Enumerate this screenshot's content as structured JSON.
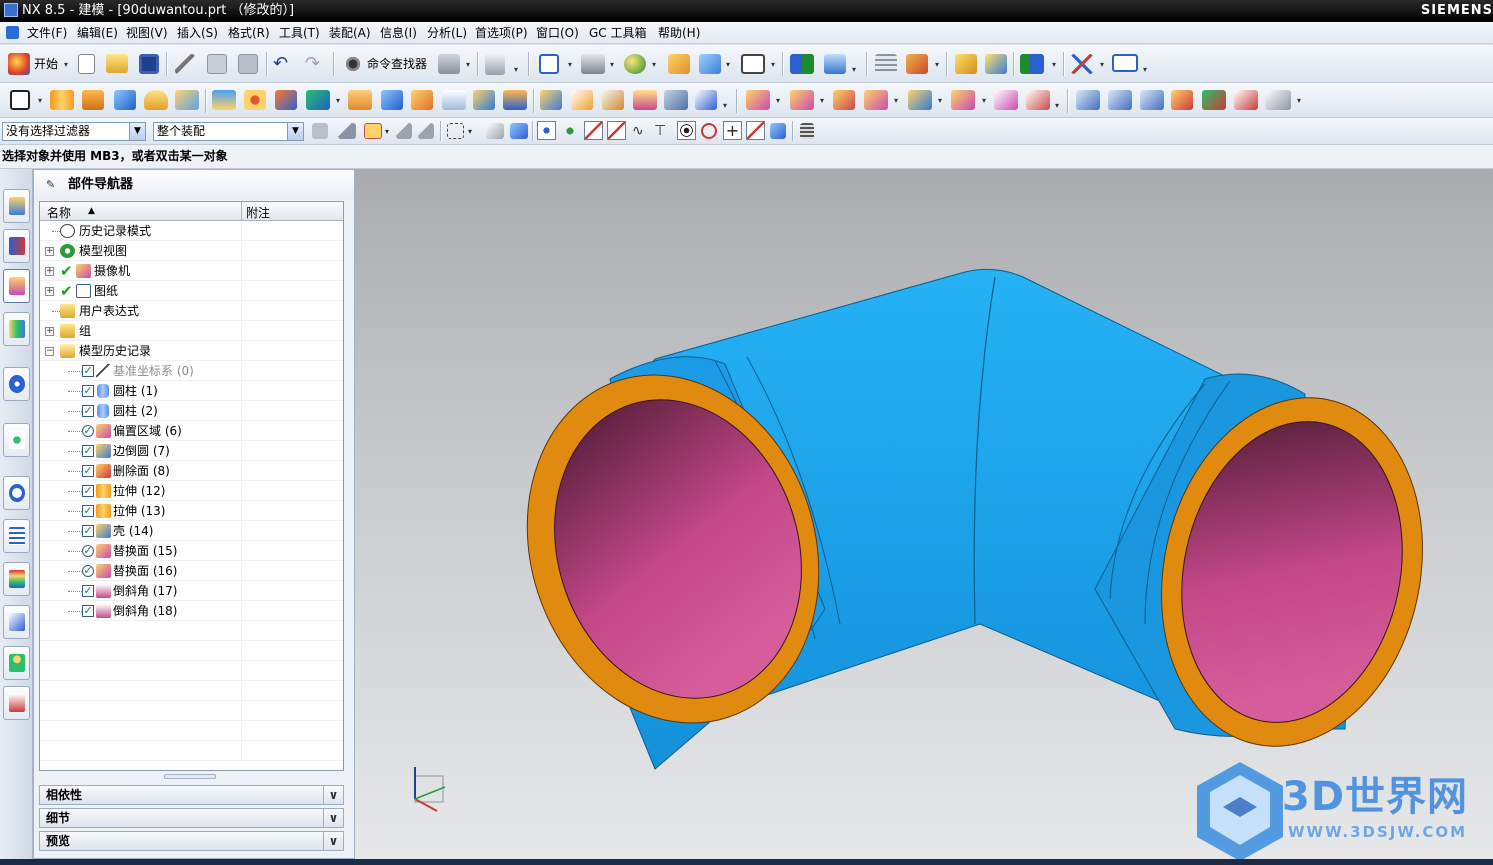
{
  "window": {
    "title": "NX 8.5 - 建模 - [90duwantou.prt （修改的）]",
    "brand": "SIEMENS"
  },
  "menu": [
    "文件(F)",
    "编辑(E)",
    "视图(V)",
    "插入(S)",
    "格式(R)",
    "工具(T)",
    "装配(A)",
    "信息(I)",
    "分析(L)",
    "首选项(P)",
    "窗口(O)",
    "GC 工具箱",
    "帮助(H)"
  ],
  "toolbar": {
    "start_label": "开始",
    "command_finder_label": "命令查找器",
    "selection_filter": "没有选择过滤器",
    "assembly_scope": "整个装配"
  },
  "cue_line": "选择对象并使用 MB3，或者双击某一对象",
  "navigator": {
    "title": "部件导航器",
    "col_name": "名称",
    "col_note": "附注",
    "items": [
      {
        "label": "历史记录模式",
        "icon": "clock-icon"
      },
      {
        "label": "模型视图",
        "icon": "model-views-icon"
      },
      {
        "label": "摄像机",
        "icon": "camera-icon"
      },
      {
        "label": "图纸",
        "icon": "drawing-icon"
      },
      {
        "label": "用户表达式",
        "icon": "folder-icon"
      },
      {
        "label": "组",
        "icon": "folder-icon"
      },
      {
        "label": "模型历史记录",
        "icon": "folder-open-icon"
      },
      {
        "label": "基准坐标系 (0)",
        "icon": "datum-csys-icon"
      },
      {
        "label": "圆柱 (1)",
        "icon": "cylinder-icon"
      },
      {
        "label": "圆柱 (2)",
        "icon": "cylinder-icon"
      },
      {
        "label": "偏置区域 (6)",
        "icon": "offset-region-icon"
      },
      {
        "label": "边倒圆 (7)",
        "icon": "edge-blend-icon"
      },
      {
        "label": "删除面 (8)",
        "icon": "delete-face-icon"
      },
      {
        "label": "拉伸 (12)",
        "icon": "extrude-icon"
      },
      {
        "label": "拉伸 (13)",
        "icon": "extrude-icon"
      },
      {
        "label": "壳 (14)",
        "icon": "shell-icon"
      },
      {
        "label": "替换面 (15)",
        "icon": "replace-face-icon"
      },
      {
        "label": "替换面 (16)",
        "icon": "replace-face-icon"
      },
      {
        "label": "倒斜角 (17)",
        "icon": "chamfer-icon"
      },
      {
        "label": "倒斜角 (18)",
        "icon": "chamfer-icon"
      }
    ],
    "panes": [
      "相依性",
      "细节",
      "预览"
    ]
  },
  "watermark": {
    "text": "3D世界网",
    "sub": "WWW.3DSJW.COM"
  },
  "colors": {
    "pipe_outer": "#1fa7ee",
    "pipe_end_face": "#e08a10",
    "pipe_inner": "#c44888"
  }
}
